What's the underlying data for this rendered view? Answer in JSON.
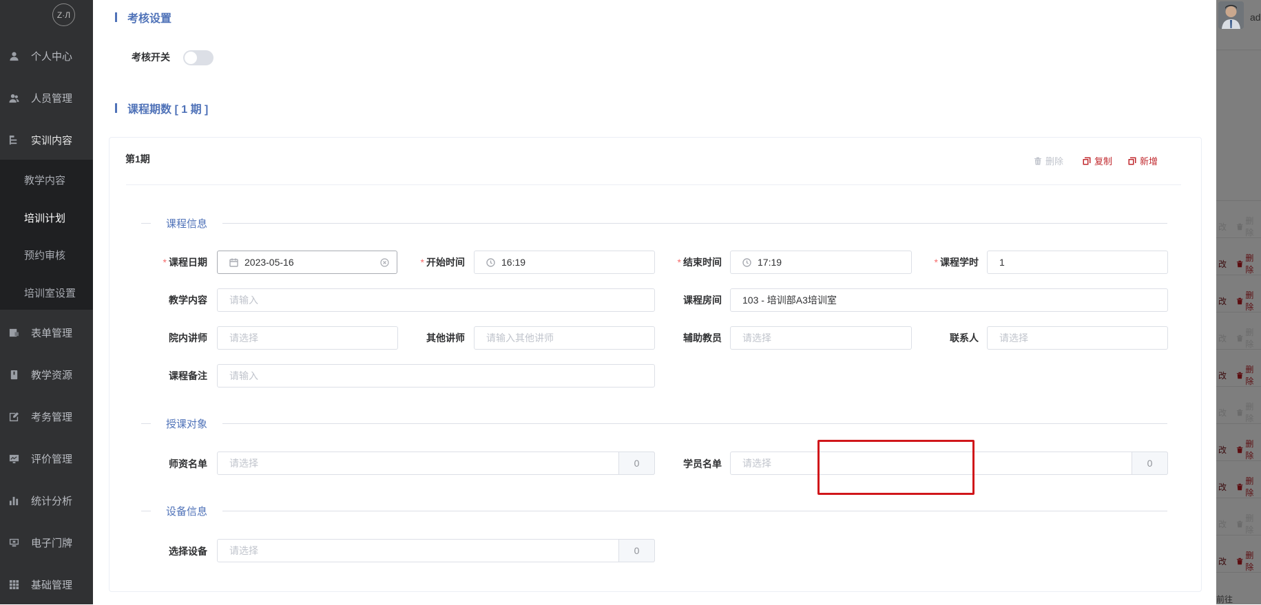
{
  "sidebar": {
    "logo_text": "Z·Л",
    "items": [
      {
        "label": "个人中心",
        "icon": "user-icon"
      },
      {
        "label": "人员管理",
        "icon": "users-icon"
      },
      {
        "label": "实训内容",
        "icon": "tree-icon"
      },
      {
        "label": "表单管理",
        "icon": "form-icon"
      },
      {
        "label": "教学资源",
        "icon": "book-icon"
      },
      {
        "label": "考务管理",
        "icon": "edit-icon"
      },
      {
        "label": "评价管理",
        "icon": "chart-board-icon"
      },
      {
        "label": "统计分析",
        "icon": "bar-chart-icon"
      },
      {
        "label": "电子门牌",
        "icon": "monitor-icon"
      },
      {
        "label": "基础管理",
        "icon": "grid-icon"
      }
    ],
    "subitems": [
      {
        "label": "教学内容"
      },
      {
        "label": "培训计划"
      },
      {
        "label": "预约审核"
      },
      {
        "label": "培训室设置"
      }
    ]
  },
  "assessment": {
    "title": "考核设置",
    "switch_label": "考核开关",
    "switch_on": false
  },
  "periods": {
    "title": "课程期数 [ 1 期 ]",
    "card": {
      "title": "第1期",
      "delete_label": "删除",
      "copy_label": "复制",
      "add_label": "新增"
    }
  },
  "course_info": {
    "group_title": "课程信息",
    "date_label": "课程日期",
    "date_value": "2023-05-16",
    "start_label": "开始时间",
    "start_value": "16:19",
    "end_label": "结束时间",
    "end_value": "17:19",
    "hours_label": "课程学时",
    "hours_value": "1",
    "content_label": "教学内容",
    "content_placeholder": "请输入",
    "room_label": "课程房间",
    "room_value": "103 - 培训部A3培训室",
    "inner_teacher_label": "院内讲师",
    "inner_teacher_placeholder": "请选择",
    "other_teacher_label": "其他讲师",
    "other_teacher_placeholder": "请输入其他讲师",
    "assistant_label": "辅助教员",
    "assistant_placeholder": "请选择",
    "contact_label": "联系人",
    "contact_placeholder": "请选择",
    "remark_label": "课程备注",
    "remark_placeholder": "请输入"
  },
  "audience": {
    "group_title": "授课对象",
    "teachers_label": "师资名单",
    "teachers_placeholder": "请选择",
    "teachers_count": "0",
    "students_label": "学员名单",
    "students_placeholder": "请选择",
    "students_count": "0"
  },
  "equipment": {
    "group_title": "设备信息",
    "select_label": "选择设备",
    "select_placeholder": "请选择",
    "select_count": "0"
  },
  "background": {
    "username": "ad",
    "row_action_a": "改",
    "row_action_b": "删除",
    "bottom_text": "前往"
  },
  "colors": {
    "accent": "#4f72b8",
    "danger": "#c0282d",
    "highlight": "#d0161a",
    "sidebar": "#303133"
  }
}
